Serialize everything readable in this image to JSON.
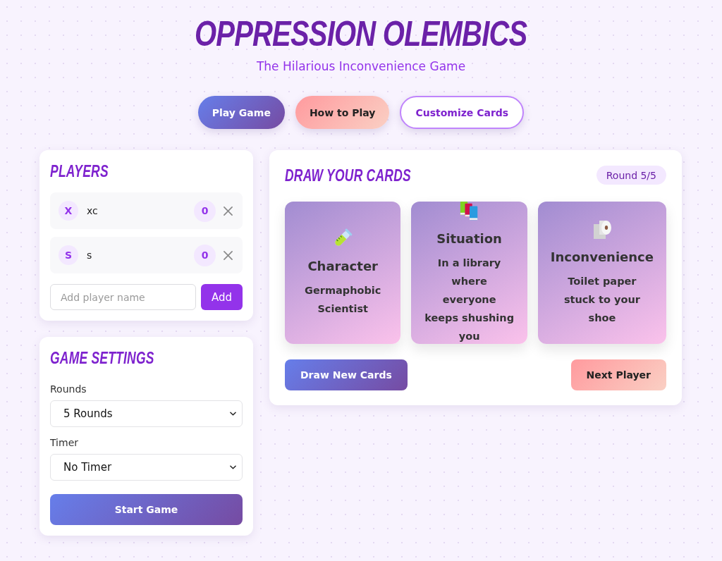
{
  "header": {
    "title": "OPPRESSION OLEMBICS",
    "subtitle": "The Hilarious Inconvenience Game"
  },
  "nav": [
    {
      "label": "Play Game",
      "kind": "primary"
    },
    {
      "label": "How to Play",
      "kind": "secondary"
    },
    {
      "label": "Customize Cards",
      "kind": "outline"
    }
  ],
  "players": {
    "title": "PLAYERS",
    "items": [
      {
        "initial": "X",
        "name": "xc",
        "score": "0"
      },
      {
        "initial": "S",
        "name": "s",
        "score": "0"
      }
    ],
    "input": {
      "placeholder": "Add player name"
    },
    "add_button": "Add"
  },
  "settings": {
    "title": "GAME SETTINGS",
    "fields": [
      {
        "label": "Rounds",
        "value": "5 Rounds"
      },
      {
        "label": "Timer",
        "value": "No Timer"
      }
    ],
    "start_button": "Start Game"
  },
  "draw": {
    "title": "DRAW YOUR CARDS",
    "round": "Round 5/5",
    "cards": [
      {
        "kind": "character",
        "title": "Character",
        "text": "Germaphobic Scientist"
      },
      {
        "kind": "situation",
        "title": "Situation",
        "text": "In a library where everyone keeps shushing you"
      },
      {
        "kind": "inconvenience",
        "title": "Inconvenience",
        "text": "Toilet paper stuck to your shoe"
      }
    ],
    "buttons": [
      {
        "label": "Draw New Cards",
        "kind": "primary"
      },
      {
        "label": "Next Player",
        "kind": "secondary"
      }
    ]
  }
}
